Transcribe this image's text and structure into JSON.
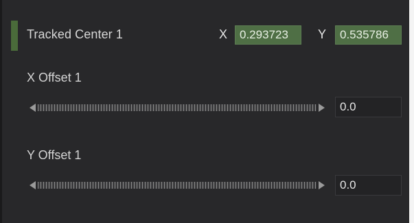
{
  "tracked_center": {
    "label": "Tracked Center 1",
    "x_label": "X",
    "x_value": "0.293723",
    "y_label": "Y",
    "y_value": "0.535786"
  },
  "x_offset": {
    "label": "X Offset 1",
    "value": "0.0"
  },
  "y_offset": {
    "label": "Y Offset 1",
    "value": "0.0"
  },
  "colors": {
    "panel_bg": "#28282a",
    "accent": "#4a6b3a",
    "coord_field_bg": "#4f6f45"
  }
}
